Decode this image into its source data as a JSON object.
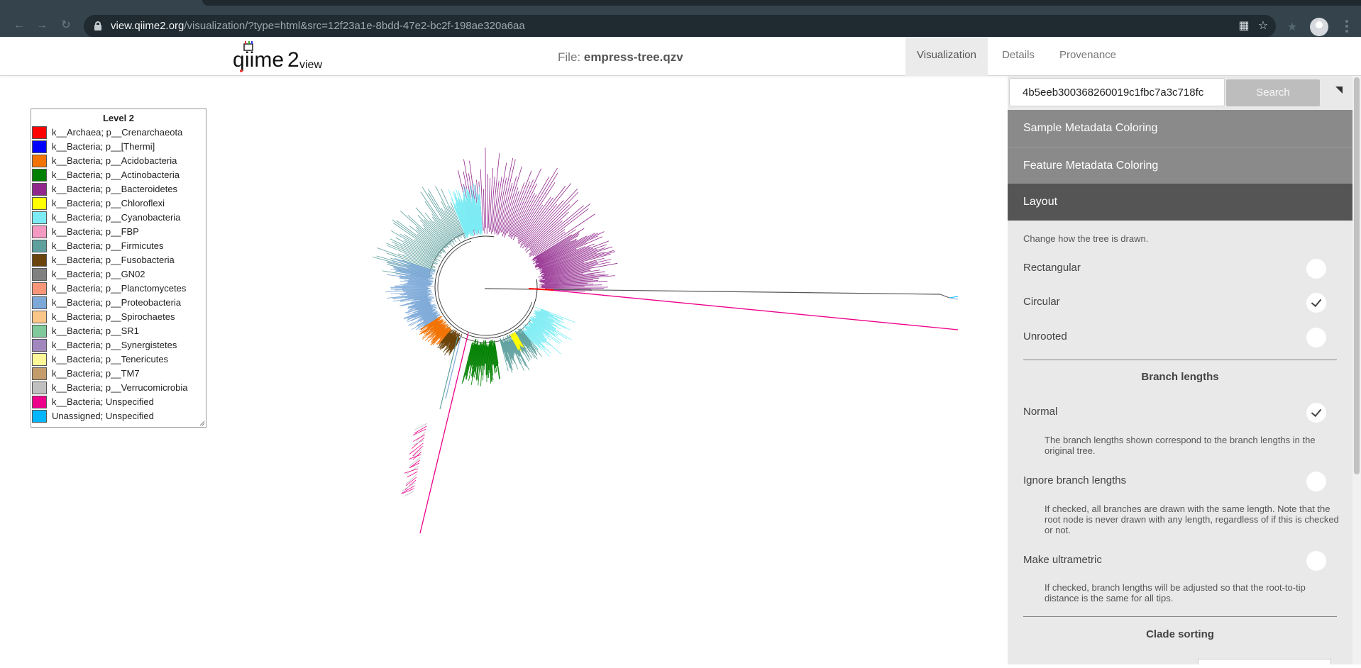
{
  "browser": {
    "url_host": "view.qiime2.org",
    "url_path": "/visualization/?type=html&src=12f23a1e-8bdd-47e2-bc2f-198ae320a6aa"
  },
  "header": {
    "file_prefix": "File:",
    "file_name": "empress-tree.qzv",
    "tabs": [
      {
        "label": "Visualization",
        "active": true
      },
      {
        "label": "Details",
        "active": false
      },
      {
        "label": "Provenance",
        "active": false
      }
    ]
  },
  "legend": {
    "title": "Level 2",
    "items": [
      {
        "label": "k__Archaea; p__Crenarchaeota",
        "color": "#ff0000"
      },
      {
        "label": "k__Bacteria; p__[Thermi]",
        "color": "#0000ff"
      },
      {
        "label": "k__Bacteria; p__Acidobacteria",
        "color": "#f27304"
      },
      {
        "label": "k__Bacteria; p__Actinobacteria",
        "color": "#008000"
      },
      {
        "label": "k__Bacteria; p__Bacteroidetes",
        "color": "#91278d"
      },
      {
        "label": "k__Bacteria; p__Chloroflexi",
        "color": "#ffff00"
      },
      {
        "label": "k__Bacteria; p__Cyanobacteria",
        "color": "#7cecf4"
      },
      {
        "label": "k__Bacteria; p__FBP",
        "color": "#f49ac2"
      },
      {
        "label": "k__Bacteria; p__Firmicutes",
        "color": "#5da09e"
      },
      {
        "label": "k__Bacteria; p__Fusobacteria",
        "color": "#6b440b"
      },
      {
        "label": "k__Bacteria; p__GN02",
        "color": "#808080"
      },
      {
        "label": "k__Bacteria; p__Planctomycetes",
        "color": "#f79679"
      },
      {
        "label": "k__Bacteria; p__Proteobacteria",
        "color": "#7da9d8"
      },
      {
        "label": "k__Bacteria; p__Spirochaetes",
        "color": "#fcc688"
      },
      {
        "label": "k__Bacteria; p__SR1",
        "color": "#80c99b"
      },
      {
        "label": "k__Bacteria; p__Synergistetes",
        "color": "#a287bf"
      },
      {
        "label": "k__Bacteria; p__Tenericutes",
        "color": "#fff899"
      },
      {
        "label": "k__Bacteria; p__TM7",
        "color": "#c49c6b"
      },
      {
        "label": "k__Bacteria; p__Verrucomicrobia",
        "color": "#c0c0c0"
      },
      {
        "label": "k__Bacteria; Unspecified",
        "color": "#ed008a"
      },
      {
        "label": "Unassigned; Unspecified",
        "color": "#00b6ff"
      }
    ]
  },
  "panel": {
    "search_value": "4b5eeb300368260019c1fbc7a3c718fc",
    "search_button": "Search",
    "sections": {
      "sample_metadata": "Sample Metadata Coloring",
      "feature_metadata": "Feature Metadata Coloring",
      "layout": "Layout"
    },
    "layout_description": "Change how the tree is drawn.",
    "layout_options": [
      {
        "label": "Rectangular",
        "checked": false
      },
      {
        "label": "Circular",
        "checked": true
      },
      {
        "label": "Unrooted",
        "checked": false
      }
    ],
    "branch_lengths_title": "Branch lengths",
    "branch_options": [
      {
        "label": "Normal",
        "checked": true,
        "help": "The branch lengths shown correspond to the branch lengths in the original tree."
      },
      {
        "label": "Ignore branch lengths",
        "checked": false,
        "help": "If checked, all branches are drawn with the same length. Note that the root node is never drawn with any length, regardless of if this is checked or not."
      },
      {
        "label": "Make ultrametric",
        "checked": false,
        "help": "If checked, branch lengths will be adjusted so that the root-to-tip distance is the same for all tips."
      }
    ],
    "clade_sorting_title": "Clade sorting"
  }
}
